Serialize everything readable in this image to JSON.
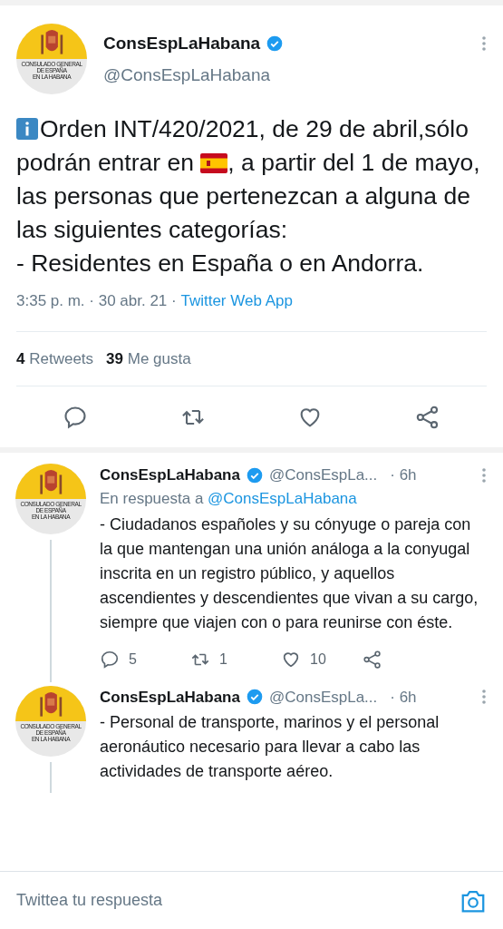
{
  "tweet": {
    "avatar_caption": [
      "CONSULADO GENERAL",
      "DE ESPAÑA",
      "EN LA HABANA"
    ],
    "name": "ConsEspLaHabana",
    "verified": true,
    "handle": "@ConsEspLaHabana",
    "text_before_flag": "Orden INT/420/2021, de 29 de abril,sólo podrán entrar en ",
    "text_after_flag": ", a partir del 1 de mayo,  las personas que pertenezcan a alguna de las siguientes categorías:\n- Residentes en España o en Andorra.",
    "time": "3:35 p. m. · 30 abr. 21 · ",
    "source": "Twitter Web App",
    "retweets_count": "4",
    "retweets_label": "Retweets",
    "likes_count": "39",
    "likes_label": "Me gusta"
  },
  "replies": [
    {
      "avatar_caption": [
        "CONSULADO GENERAL",
        "DE ESPAÑA",
        "EN LA HABANA"
      ],
      "name": "ConsEspLaHabana",
      "verified": true,
      "handle": "@ConsEspLa...",
      "age": "· 6h",
      "reply_prefix": "En respuesta a ",
      "reply_to": "@ConsEspLaHabana",
      "text": "- Ciudadanos españoles y su cónyuge o pareja con la que mantengan una unión análoga a la conyugal inscrita en un registro público, y aquellos ascendientes y descendientes que vivan a su cargo, siempre que viajen con o para reunirse con éste.",
      "counts": {
        "replies": "5",
        "retweets": "1",
        "likes": "10"
      }
    },
    {
      "avatar_caption": [
        "CONSULADO GENERAL",
        "DE ESPAÑA",
        "EN LA HABANA"
      ],
      "name": "ConsEspLaHabana",
      "verified": true,
      "handle": "@ConsEspLa...",
      "age": "· 6h",
      "text": "- Personal de transporte, marinos y el personal aeronáutico necesario para llevar a cabo las actividades de transporte aéreo."
    }
  ],
  "composer": {
    "placeholder": "Twittea tu respuesta"
  }
}
